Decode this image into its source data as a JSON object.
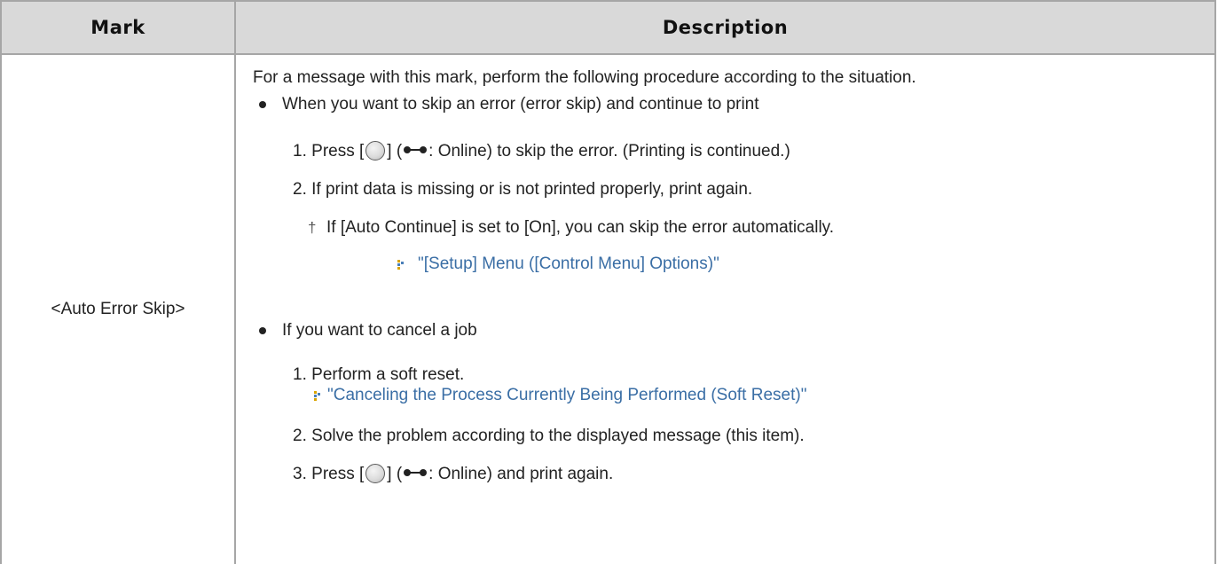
{
  "header": {
    "mark": "Mark",
    "description": "Description"
  },
  "row": {
    "mark": "<Auto Error Skip>",
    "intro": "For a message with this mark, perform the following procedure according to the situation.",
    "section1": {
      "bullet": "When you want to skip an error (error skip) and continue to print",
      "step1": {
        "number": "1.",
        "pre": "Press [",
        "mid": "] (",
        "post": ": Online) to skip the error. (Printing is continued.)"
      },
      "step2": {
        "number": "2.",
        "text": "If print data is missing or is not printed properly, print again."
      },
      "note": "If [Auto Continue] is set to [On], you can skip the error automatically.",
      "link": "\"[Setup] Menu ([Control Menu] Options)\""
    },
    "section2": {
      "bullet": "If you want to cancel a job",
      "step1": {
        "number": "1.",
        "text": "Perform a soft reset.",
        "link": "\"Canceling the Process Currently Being Performed (Soft Reset)\""
      },
      "step2": {
        "number": "2.",
        "text": "Solve the problem according to the displayed message (this item)."
      },
      "step3": {
        "number": "3.",
        "pre": "Press [",
        "mid": "] (",
        "post": ": Online) and print again."
      }
    }
  },
  "colors": {
    "header_bg": "#d9d9d9",
    "border": "#a6a6a6",
    "link": "#3a6ea5"
  },
  "icons": {
    "button": "online-button-icon",
    "online": "online-key-icon",
    "note": "dagger-note-icon",
    "link_arrow": "link-arrow-icon"
  }
}
